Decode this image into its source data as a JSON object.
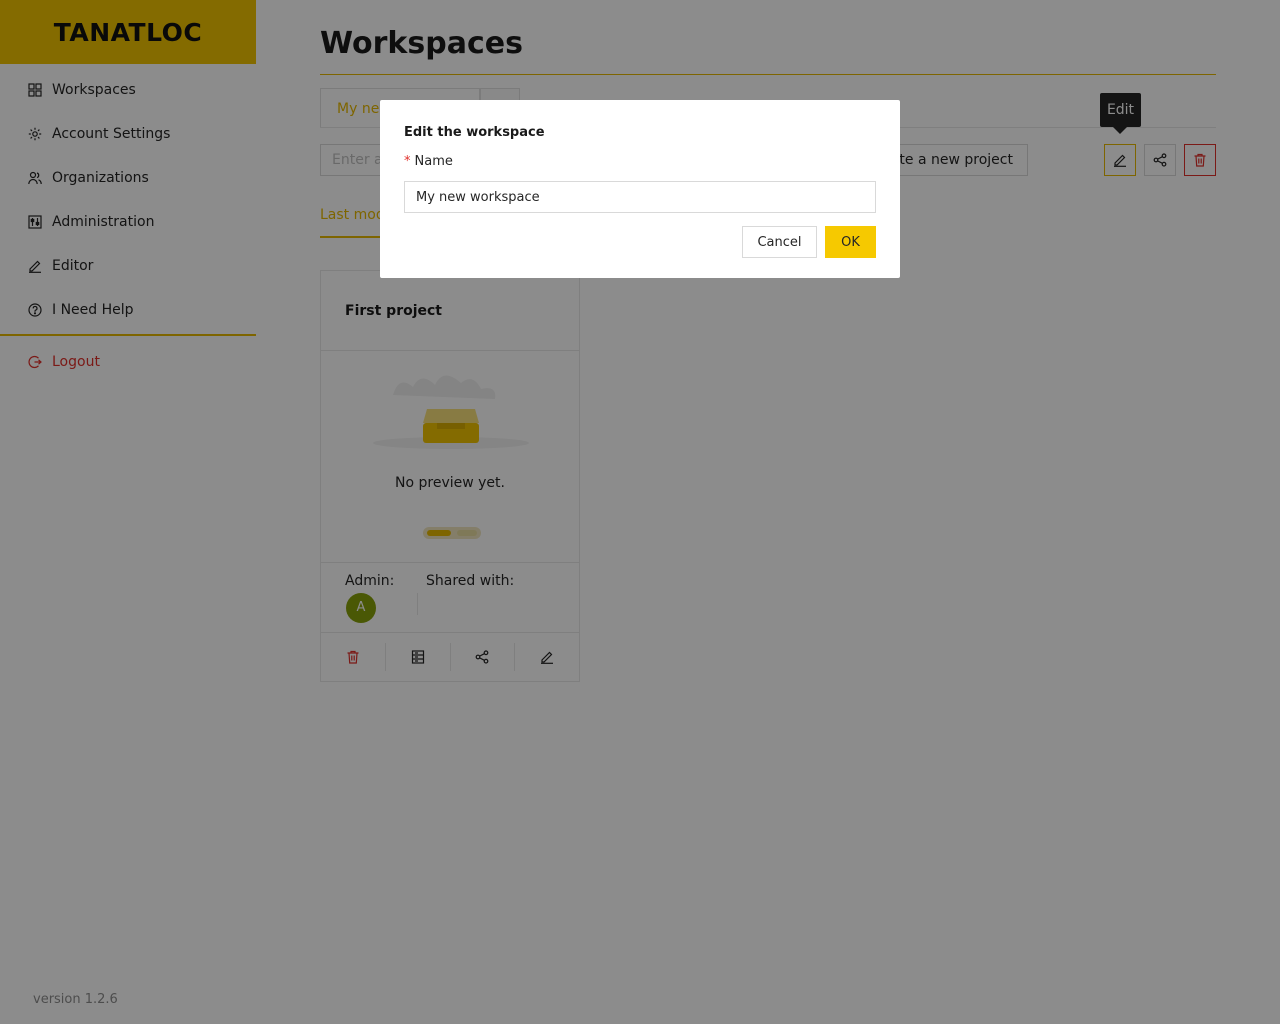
{
  "brand": {
    "logo_text": "TANATLOC",
    "accent_color": "#f0c400",
    "danger_color": "#e0302b"
  },
  "sidebar": {
    "items": [
      {
        "label": "Workspaces",
        "icon": "grid-icon"
      },
      {
        "label": "Account Settings",
        "icon": "gear-icon"
      },
      {
        "label": "Organizations",
        "icon": "users-icon"
      },
      {
        "label": "Administration",
        "icon": "sliders-icon"
      },
      {
        "label": "Editor",
        "icon": "pencil-icon"
      },
      {
        "label": "I Need Help",
        "icon": "help-circle-icon"
      }
    ],
    "logout_label": "Logout",
    "version": "version 1.2.6"
  },
  "main": {
    "title": "Workspaces",
    "tabs": [
      {
        "label": "My new workspace"
      }
    ],
    "search": {
      "placeholder": "Enter a"
    },
    "create_button_label": "eate a new project",
    "tooltip": "Edit",
    "sort_tab_label": "Last mod"
  },
  "card": {
    "title": "First project",
    "preview_text": "No preview yet.",
    "admin_label": "Admin:",
    "shared_label": "Shared with:",
    "avatar_letter": "A"
  },
  "modal": {
    "title": "Edit the workspace",
    "required_mark": "*",
    "field_label": "Name",
    "field_value": "My new workspace",
    "cancel_label": "Cancel",
    "ok_label": "OK"
  }
}
